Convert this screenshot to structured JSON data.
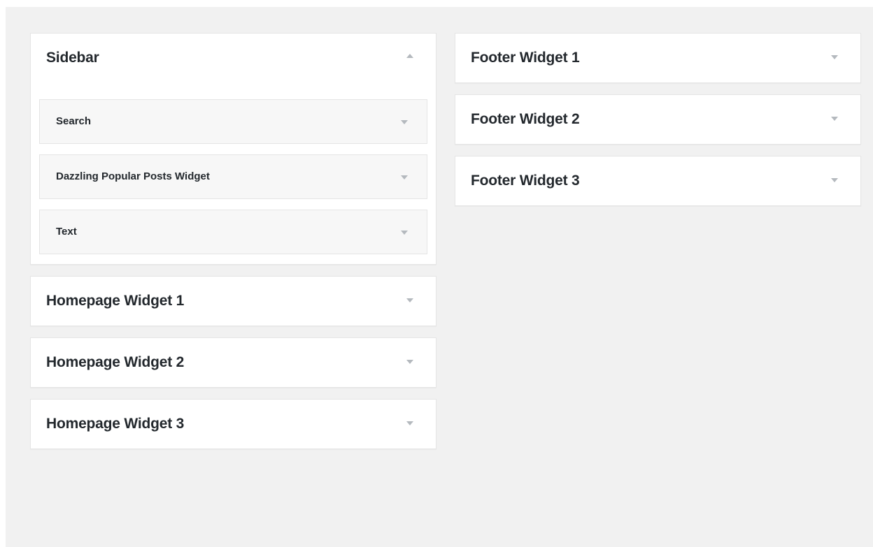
{
  "left_column": {
    "sidebar": {
      "title": "Sidebar",
      "widgets": [
        {
          "label": "Search"
        },
        {
          "label": "Dazzling Popular Posts Widget"
        },
        {
          "label": "Text"
        }
      ]
    },
    "areas": [
      {
        "title": "Homepage Widget 1"
      },
      {
        "title": "Homepage Widget 2"
      },
      {
        "title": "Homepage Widget 3"
      }
    ]
  },
  "right_column": {
    "areas": [
      {
        "title": "Footer Widget 1"
      },
      {
        "title": "Footer Widget 2"
      },
      {
        "title": "Footer Widget 3"
      }
    ]
  },
  "icons": {
    "collapse": "triangle-up-icon",
    "expand": "triangle-down-icon"
  },
  "colors": {
    "background": "#f1f1f1",
    "panel": "#ffffff",
    "widget": "#f7f7f7",
    "text": "#23282d",
    "arrow": "#b4b9be"
  }
}
